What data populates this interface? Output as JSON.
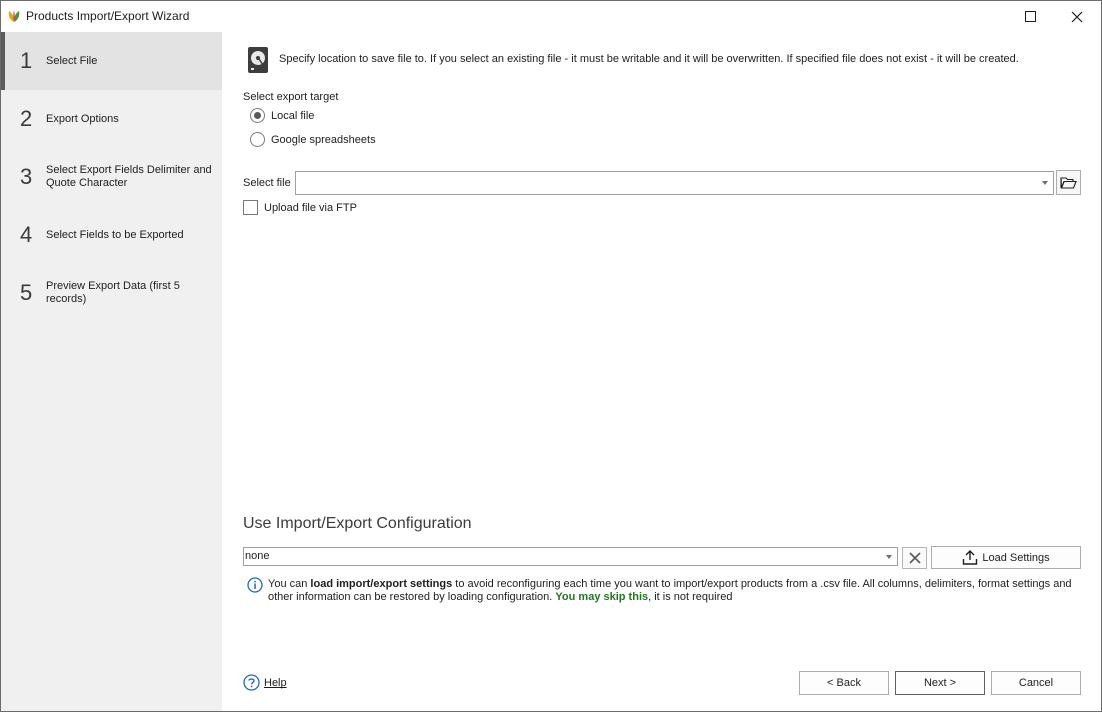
{
  "window": {
    "title": "Products Import/Export Wizard"
  },
  "steps": [
    {
      "num": "1",
      "label": "Select File",
      "active": true
    },
    {
      "num": "2",
      "label": "Export Options",
      "active": false
    },
    {
      "num": "3",
      "label": "Select Export Fields Delimiter and Quote Character",
      "active": false
    },
    {
      "num": "4",
      "label": "Select Fields to be Exported",
      "active": false
    },
    {
      "num": "5",
      "label": "Preview Export Data (first 5 records)",
      "active": false
    }
  ],
  "content": {
    "description": "Specify location to save file to. If you select an existing file - it must be writable and it will be overwritten. If specified file does not exist - it will be created.",
    "export_target_label": "Select export target",
    "radio_local": "Local file",
    "radio_google": "Google spreadsheets",
    "select_file_label": "Select file",
    "select_file_value": "",
    "ftp_label": "Upload file via FTP",
    "config_title": "Use Import/Export Configuration",
    "config_value": "none",
    "load_settings_label": "Load Settings",
    "info_pre": "You can ",
    "info_bold": "load import/export settings",
    "info_mid": " to avoid reconfiguring each time you want to import/export products from a .csv file. All columns, delimiters, format settings and other information can be restored by loading configuration. ",
    "info_green": "You may skip this",
    "info_post": ", it is not required"
  },
  "footer": {
    "help_label": "Help",
    "back_label": "< Back",
    "next_label": "Next >",
    "cancel_label": "Cancel"
  },
  "colors": {
    "accent_green": "#1f7a1f",
    "sidebar_bg": "#f0f0f0",
    "info_blue": "#1c6bbf"
  }
}
